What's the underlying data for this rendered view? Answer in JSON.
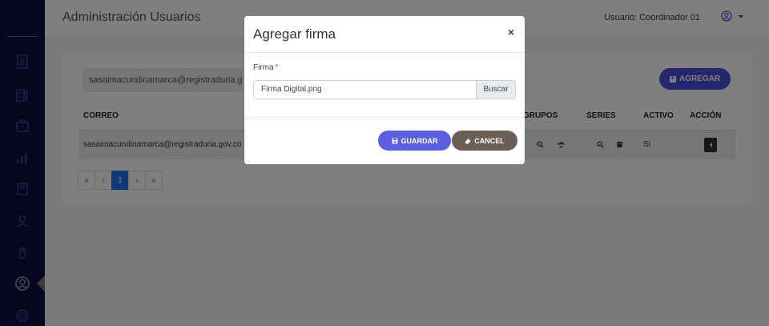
{
  "header": {
    "page_title": "Administración Usuarios",
    "user_label": "Usuario: Coordinador 01"
  },
  "sidebar": {
    "icons": [
      "document-icon",
      "list-icon",
      "briefcase-icon",
      "bar-chart-icon",
      "book-icon",
      "user-icon",
      "hand-icon",
      "user-circle-icon",
      "fingerprint-icon"
    ],
    "active": "user-circle-icon"
  },
  "card": {
    "email_chip": "sasaimacundinamarca@registraduria.gov.co",
    "add_button": "AGREGAR"
  },
  "table": {
    "headers": {
      "correo": "CORREO",
      "grupos": "GRUPOS",
      "series": "SERIES",
      "activo": "ACTIVO",
      "accion": "ACCIÓN"
    },
    "rows": [
      {
        "correo": "sasaimacundinamarca@registraduria.gov.co",
        "activo": "Si"
      }
    ]
  },
  "pagination": [
    "«",
    "‹",
    "1",
    "›",
    "»"
  ],
  "modal": {
    "title": "Agregar firma",
    "close": "×",
    "field_label": "Firma",
    "required_mark": "*",
    "file_value": "Firma Digital.png",
    "browse_label": "Buscar",
    "save_label": "GUARDAR",
    "cancel_label": "CANCEL"
  },
  "colors": {
    "sidebar_bg": "#0d0c3f",
    "primary": "#5b5fe0",
    "cancel": "#6b5f55",
    "required": "#d9534f",
    "pagination_active": "#1a73e8"
  }
}
